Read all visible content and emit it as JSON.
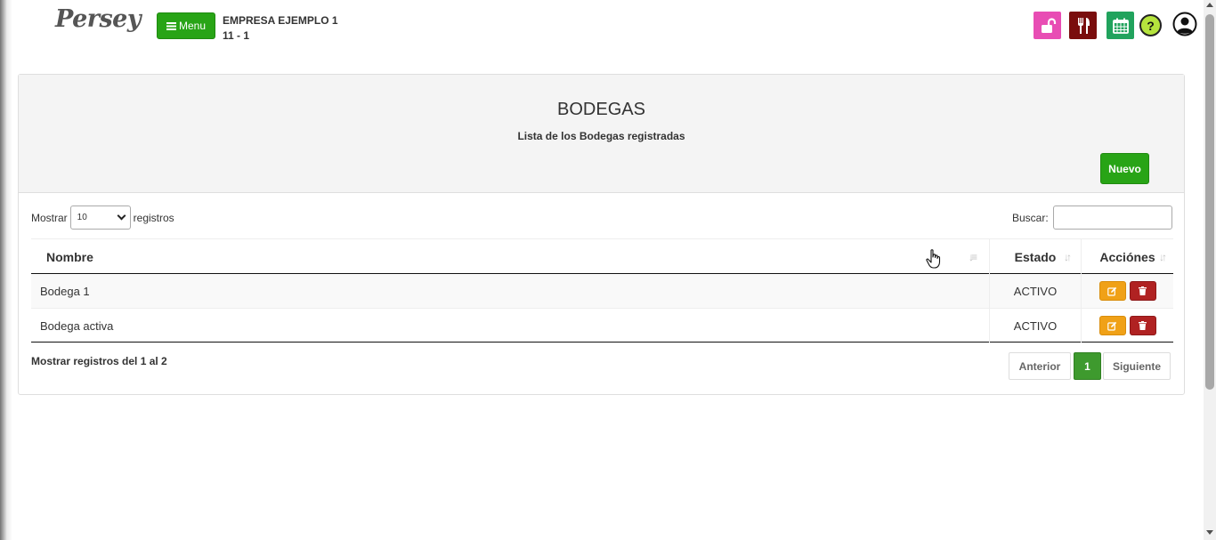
{
  "header": {
    "logo_text": "Persey",
    "menu_label": "Menu",
    "company_name": "EMPRESA EJEMPLO 1",
    "company_code": "11 - 1",
    "icons": [
      "lock-open-icon",
      "utensils-icon",
      "calendar-icon",
      "help-icon",
      "user-circle-icon"
    ],
    "help_glyph": "?",
    "colors": {
      "lock": "#e84db4",
      "food": "#7a0d0d",
      "calendar": "#21a35d",
      "help": "#b5e43d",
      "menu": "#28a416"
    }
  },
  "page": {
    "title": "BODEGAS",
    "subtitle": "Lista de los Bodegas registradas",
    "new_button": "Nuevo"
  },
  "controls": {
    "show_label": "Mostrar",
    "page_size": "10",
    "records_label": "registros",
    "search_label": "Buscar:",
    "search_value": ""
  },
  "table": {
    "columns": [
      "Nombre",
      "Estado",
      "Acciónes"
    ],
    "rows": [
      {
        "nombre": "Bodega 1",
        "estado": "ACTIVO"
      },
      {
        "nombre": "Bodega activa",
        "estado": "ACTIVO"
      }
    ]
  },
  "footer": {
    "info": "Mostrar registros del 1 al 2",
    "prev": "Anterior",
    "current_page": "1",
    "next": "Siguiente"
  }
}
